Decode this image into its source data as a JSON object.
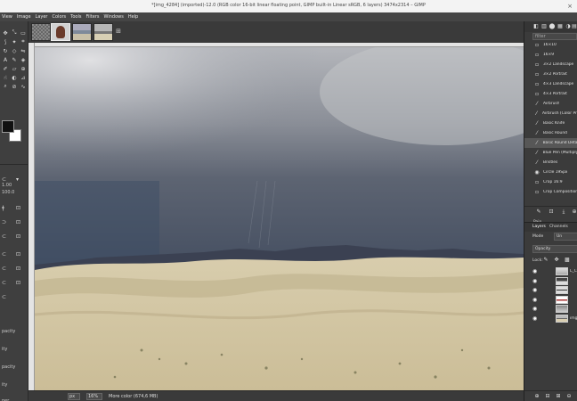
{
  "window": {
    "title": "*[img_4284] (imported)-12.0 (RGB color 16-bit linear floating point, GIMP built-in Linear sRGB, 6 layers) 3474x2314 – GIMP",
    "close_glyph": "×"
  },
  "menu": [
    "View",
    "Image",
    "Layer",
    "Colors",
    "Tools",
    "Filters",
    "Windows",
    "Help"
  ],
  "image_tabs": {
    "more_glyph": "⊞"
  },
  "toolbox": {
    "tools": [
      {
        "icon": "move-icon",
        "glyph": "✥"
      },
      {
        "icon": "alignment-icon",
        "glyph": "⤡"
      },
      {
        "icon": "rect-select-icon",
        "glyph": "▭"
      },
      {
        "icon": "lasso-icon",
        "glyph": "⟆"
      },
      {
        "icon": "fuzzy-select-icon",
        "glyph": "✦"
      },
      {
        "icon": "crop-icon",
        "glyph": "⌗"
      },
      {
        "icon": "rotate-icon",
        "glyph": "↻"
      },
      {
        "icon": "cage-icon",
        "glyph": "◇"
      },
      {
        "icon": "flip-icon",
        "glyph": "⇋"
      },
      {
        "icon": "text-icon",
        "glyph": "A"
      },
      {
        "icon": "paths-icon",
        "glyph": "✎"
      },
      {
        "icon": "bucket-fill-icon",
        "glyph": "◈"
      },
      {
        "icon": "paintbrush-icon",
        "glyph": "✐"
      },
      {
        "icon": "eraser-icon",
        "glyph": "▱"
      },
      {
        "icon": "clone-icon",
        "glyph": "⊕"
      },
      {
        "icon": "smudge-icon",
        "glyph": "☝"
      },
      {
        "icon": "dodge-icon",
        "glyph": "◐"
      },
      {
        "icon": "measure-icon",
        "glyph": "⊿"
      },
      {
        "icon": "zoom-icon",
        "glyph": "⌕"
      },
      {
        "icon": "color-picker-icon",
        "glyph": "⊘"
      },
      {
        "icon": "warp-icon",
        "glyph": "∿"
      }
    ],
    "options": {
      "row1": "1.00",
      "row2": "100.0",
      "labels": [
        "pacity",
        "ity",
        "pacity",
        "ity",
        "per"
      ]
    },
    "option_glyphs": [
      "⊂",
      "ǂ",
      "⊃",
      "⊂",
      "⊂",
      "⊂",
      "⊂",
      "⊂"
    ],
    "option_glyphs2": [
      "▾",
      "⊡",
      "⊡",
      "⊡",
      "⊡",
      "⊡",
      "⊡"
    ]
  },
  "status": {
    "unit": "px",
    "zoom": "16%",
    "message": "More color (674,6 MB)"
  },
  "brushes": {
    "dock_tabs": [
      "◧",
      "▥",
      "⬤",
      "▦",
      "◑",
      "▤"
    ],
    "filter_placeholder": "filter",
    "items": [
      "16×10",
      "16×9",
      "3×2 Landscape",
      "3×2 Portrait",
      "4×3 Landscape",
      "4×3 Portrait",
      "Airbrush",
      "Airbrush (Color Prom",
      "Basic Knife",
      "Basic Round",
      "Basic Round Detail",
      "Blue Pen (Multiply)",
      "Bristles",
      "Circle 19Spx",
      "Crop 16:9",
      "Crop Composition"
    ],
    "item_glyphs": [
      "▫",
      "▫",
      "▫",
      "▫",
      "▫",
      "▫",
      "⁄",
      "⁄",
      "⁄",
      "⁄",
      "⁄",
      "⁄",
      "⁄",
      "◉",
      "▫",
      "▫"
    ],
    "selected_index": 10,
    "current_name": "Pain",
    "buttons": [
      "✎",
      "⊡",
      "⤓",
      "⊕"
    ]
  },
  "layers": {
    "tabs": [
      "Layers",
      "Channels"
    ],
    "mode_label": "Mode",
    "mode_value": "Un",
    "opacity_label": "Opacity",
    "lock_label": "Lock:",
    "lock_icons": [
      "✎",
      "✥",
      "▩"
    ],
    "eye_glyph": "◉",
    "rows": [
      {
        "name": "L_C"
      },
      {
        "name": ""
      },
      {
        "name": ""
      },
      {
        "name": ""
      },
      {
        "name": ""
      },
      {
        "name": "img"
      }
    ],
    "buttons": [
      "⊕",
      "⊟",
      "⊞",
      "⊖"
    ]
  }
}
